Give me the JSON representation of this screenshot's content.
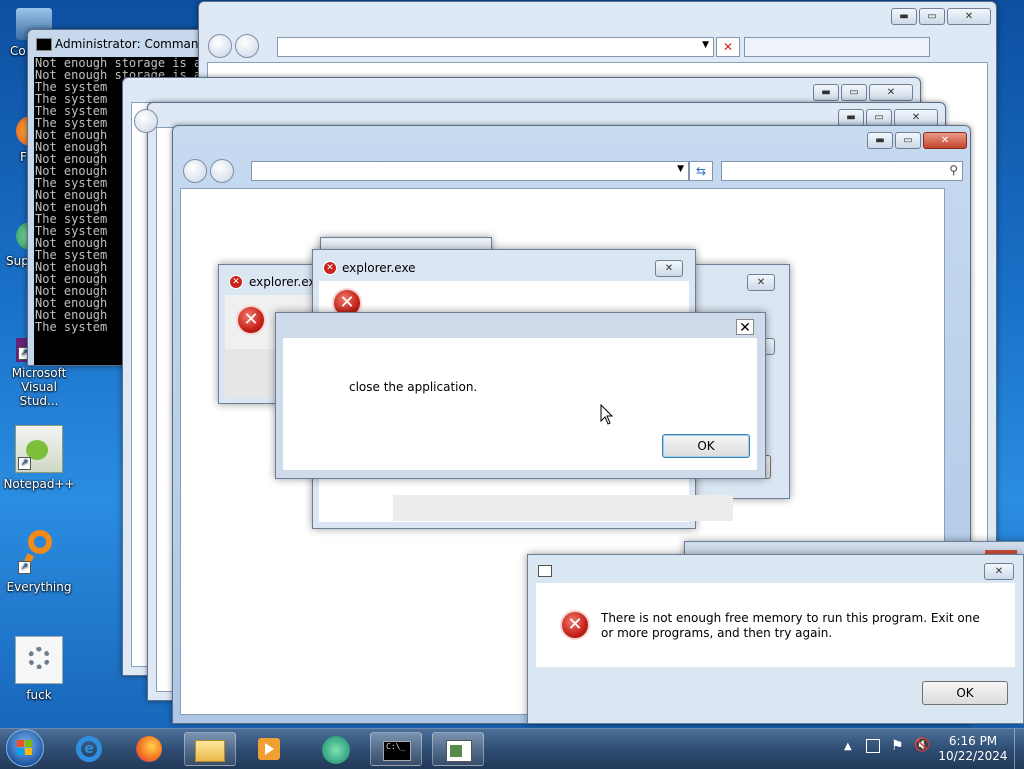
{
  "desktop": {
    "icons": [
      {
        "label": "Co"
      },
      {
        "label": "F"
      },
      {
        "label": "Sup"
      },
      {
        "label": "Microsoft Visual Stud..."
      },
      {
        "label": "Notepad++"
      },
      {
        "label": "Everything"
      },
      {
        "label": "fuck"
      }
    ]
  },
  "cmd": {
    "title": "Administrator: Command",
    "lines": [
      "Not enough storage is available to process this command.",
      "Not enough storage is available to process this command.",
      "The system",
      "The system",
      "The system",
      "The system",
      "Not enough",
      "Not enough",
      "Not enough",
      "Not enough",
      "The system",
      "Not enough",
      "Not enough",
      "The system",
      "The system",
      "Not enough",
      "The system",
      "Not enough",
      "Not enough",
      "Not enough",
      "Not enough",
      "Not enough",
      "The system"
    ]
  },
  "explorer_windows": {
    "small_title_1": "explorer.exe",
    "small_title_2": "explorer.exe"
  },
  "main_dialog": {
    "message": "close the application.",
    "ok_label": "OK",
    "close_glyph": "✕"
  },
  "memory_dialog": {
    "message": "There is not enough free memory to run this program. Exit one or more programs, and then try again.",
    "ok_label": "OK",
    "close_glyph": "✕"
  },
  "caption_glyphs": {
    "minimize": "▬",
    "maximize": "▭",
    "close": "✕"
  },
  "taskbar": {
    "clock_time": "6:16 PM",
    "clock_date": "10/22/2024"
  }
}
